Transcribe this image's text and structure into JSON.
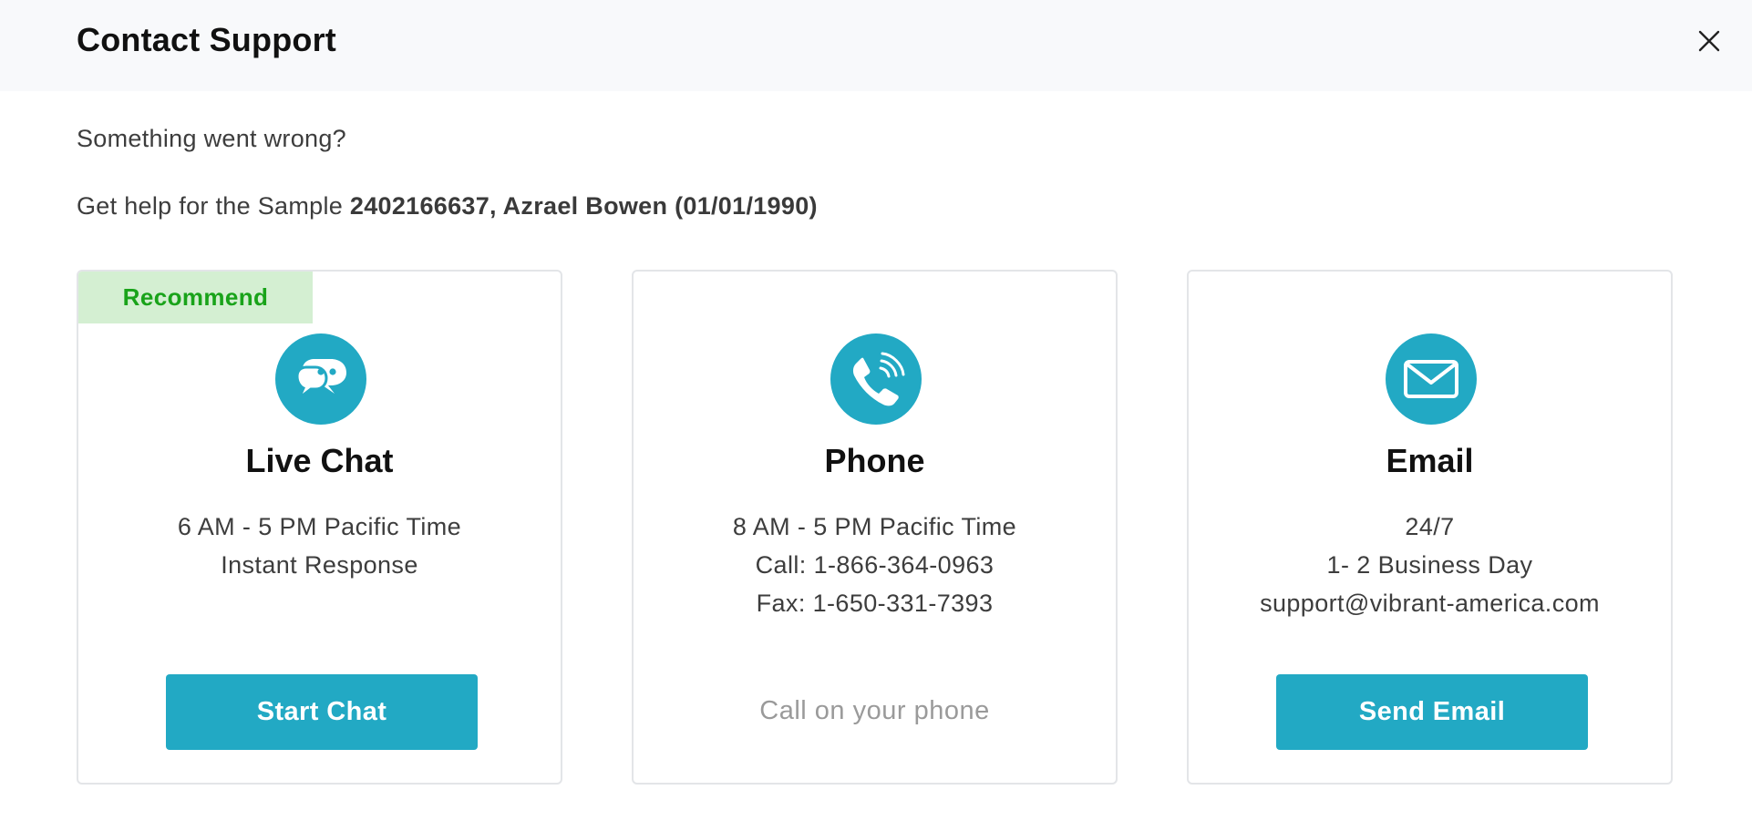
{
  "dialog": {
    "title": "Contact Support",
    "close_icon": "close-icon"
  },
  "intro": {
    "line1": "Something went wrong?",
    "line2_prefix": "Get help for the Sample ",
    "line2_bold": "2402166637, Azrael Bowen (01/01/1990)"
  },
  "colors": {
    "accent": "#22a9c4",
    "recommend_bg": "#d4efd2",
    "recommend_text": "#19a31a",
    "header_bg": "#f8f9fb"
  },
  "cards": {
    "chat": {
      "badge": "Recommend",
      "icon": "chat-bubbles-icon",
      "title": "Live Chat",
      "lines": [
        "6 AM - 5 PM Pacific Time",
        "Instant Response"
      ],
      "button": "Start Chat"
    },
    "phone": {
      "icon": "phone-icon",
      "title": "Phone",
      "lines": [
        "8 AM - 5 PM Pacific Time",
        "Call: 1-866-364-0963",
        "Fax: 1-650-331-7393"
      ],
      "action": "Call on your phone"
    },
    "email": {
      "icon": "envelope-icon",
      "title": "Email",
      "lines": [
        "24/7",
        "1- 2 Business Day",
        "support@vibrant-america.com"
      ],
      "button": "Send Email"
    }
  }
}
